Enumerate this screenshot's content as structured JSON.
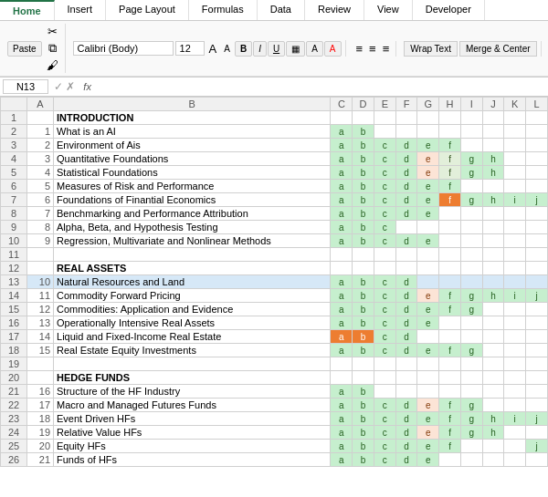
{
  "ribbon": {
    "tabs": [
      "Home",
      "Insert",
      "Page Layout",
      "Formulas",
      "Data",
      "Review",
      "View",
      "Developer"
    ],
    "active_tab": "Home",
    "font_name": "Calibri (Body)",
    "font_size": "12",
    "wrap_text": "Wrap Text",
    "merge_center": "Merge & Center"
  },
  "formula_bar": {
    "cell_ref": "N13",
    "fx": "fx",
    "formula": ""
  },
  "columns": [
    "",
    "A",
    "B",
    "C",
    "D",
    "E",
    "F",
    "G",
    "H",
    "I",
    "J",
    "K",
    "L"
  ],
  "rows": [
    {
      "row": "1",
      "num": "",
      "label": "INTRODUCTION",
      "cells": []
    },
    {
      "row": "2",
      "num": "1",
      "label": "What is an AI",
      "cells": [
        "a",
        "b",
        "",
        "",
        "",
        "",
        "",
        "",
        "",
        "",
        ""
      ]
    },
    {
      "row": "3",
      "num": "2",
      "label": "Environment of Ais",
      "cells": [
        "a",
        "b",
        "c",
        "d",
        "e",
        "f",
        "",
        "",
        "",
        "",
        ""
      ]
    },
    {
      "row": "4",
      "num": "3",
      "label": "Quantitative Foundations",
      "cells": [
        "a",
        "b",
        "c",
        "d",
        "e",
        "f",
        "g",
        "h",
        "",
        "",
        ""
      ]
    },
    {
      "row": "5",
      "num": "4",
      "label": "Statistical Foundations",
      "cells": [
        "a",
        "b",
        "c",
        "d",
        "e",
        "f",
        "g",
        "h",
        "",
        "",
        ""
      ]
    },
    {
      "row": "6",
      "num": "5",
      "label": "Measures of Risk and Performance",
      "cells": [
        "a",
        "b",
        "c",
        "d",
        "e",
        "f",
        "",
        "",
        "",
        "",
        ""
      ]
    },
    {
      "row": "7",
      "num": "6",
      "label": "Foundations of Finantial Economics",
      "cells": [
        "a",
        "b",
        "c",
        "d",
        "e",
        "f",
        "g",
        "h",
        "i",
        "j",
        ""
      ]
    },
    {
      "row": "8",
      "num": "7",
      "label": "Benchmarking and Performance Attribution",
      "cells": [
        "a",
        "b",
        "c",
        "d",
        "e",
        "",
        "",
        "",
        "",
        "",
        ""
      ]
    },
    {
      "row": "9",
      "num": "8",
      "label": "Alpha, Beta, and Hypothesis Testing",
      "cells": [
        "a",
        "b",
        "c",
        "",
        "",
        "",
        "",
        "",
        "",
        "",
        ""
      ]
    },
    {
      "row": "10",
      "num": "9",
      "label": "Regression, Multivariate and Nonlinear Methods",
      "cells": [
        "a",
        "b",
        "c",
        "d",
        "e",
        "",
        "",
        "",
        "",
        "",
        ""
      ]
    },
    {
      "row": "11",
      "num": "",
      "label": "",
      "cells": []
    },
    {
      "row": "12",
      "num": "",
      "label": "REAL ASSETS",
      "cells": []
    },
    {
      "row": "13",
      "num": "10",
      "label": "Natural Resources and Land",
      "cells": [
        "a",
        "b",
        "c",
        "d",
        "",
        "",
        "",
        "",
        "",
        "",
        ""
      ]
    },
    {
      "row": "14",
      "num": "11",
      "label": "Commodity Forward Pricing",
      "cells": [
        "a",
        "b",
        "c",
        "d",
        "e",
        "f",
        "g",
        "h",
        "i",
        "j",
        ""
      ]
    },
    {
      "row": "15",
      "num": "12",
      "label": "Commodities: Application and Evidence",
      "cells": [
        "a",
        "b",
        "c",
        "d",
        "e",
        "f",
        "g",
        "",
        "",
        "",
        ""
      ]
    },
    {
      "row": "16",
      "num": "13",
      "label": "Operationally Intensive Real Assets",
      "cells": [
        "a",
        "b",
        "c",
        "d",
        "e",
        "",
        "",
        "",
        "",
        "",
        ""
      ]
    },
    {
      "row": "17",
      "num": "14",
      "label": "Liquid and Fixed-Income Real Estate",
      "cells": [
        "a",
        "b",
        "c",
        "d",
        "",
        "",
        "",
        "",
        "",
        "",
        ""
      ]
    },
    {
      "row": "18",
      "num": "15",
      "label": "Real Estate Equity Investments",
      "cells": [
        "a",
        "b",
        "c",
        "d",
        "e",
        "f",
        "g",
        "",
        "",
        "",
        ""
      ]
    },
    {
      "row": "19",
      "num": "",
      "label": "",
      "cells": []
    },
    {
      "row": "20",
      "num": "",
      "label": "HEDGE FUNDS",
      "cells": []
    },
    {
      "row": "21",
      "num": "16",
      "label": "Structure of the HF Industry",
      "cells": [
        "a",
        "b",
        "",
        "",
        "",
        "",
        "",
        "",
        "",
        "",
        ""
      ]
    },
    {
      "row": "22",
      "num": "17",
      "label": "Macro and Managed Futures Funds",
      "cells": [
        "a",
        "b",
        "c",
        "d",
        "e",
        "f",
        "g",
        "",
        "",
        "",
        ""
      ]
    },
    {
      "row": "23",
      "num": "18",
      "label": "Event Driven HFs",
      "cells": [
        "a",
        "b",
        "c",
        "d",
        "e",
        "f",
        "g",
        "h",
        "i",
        "j",
        ""
      ]
    },
    {
      "row": "24",
      "num": "19",
      "label": "Relative Value HFs",
      "cells": [
        "a",
        "b",
        "c",
        "d",
        "e",
        "f",
        "g",
        "h",
        "",
        "",
        ""
      ]
    },
    {
      "row": "25",
      "num": "20",
      "label": "Equity HFs",
      "cells": [
        "a",
        "b",
        "c",
        "d",
        "e",
        "f",
        "",
        "",
        "",
        "j",
        ""
      ]
    },
    {
      "row": "26",
      "num": "21",
      "label": "Funds of HFs",
      "cells": [
        "a",
        "b",
        "c",
        "d",
        "e",
        "",
        "",
        "",
        "",
        "",
        ""
      ]
    }
  ],
  "cell_styles": {
    "special_rows": [
      13
    ],
    "orange_cells": {
      "row7_h": true,
      "row17_ab": true
    }
  }
}
